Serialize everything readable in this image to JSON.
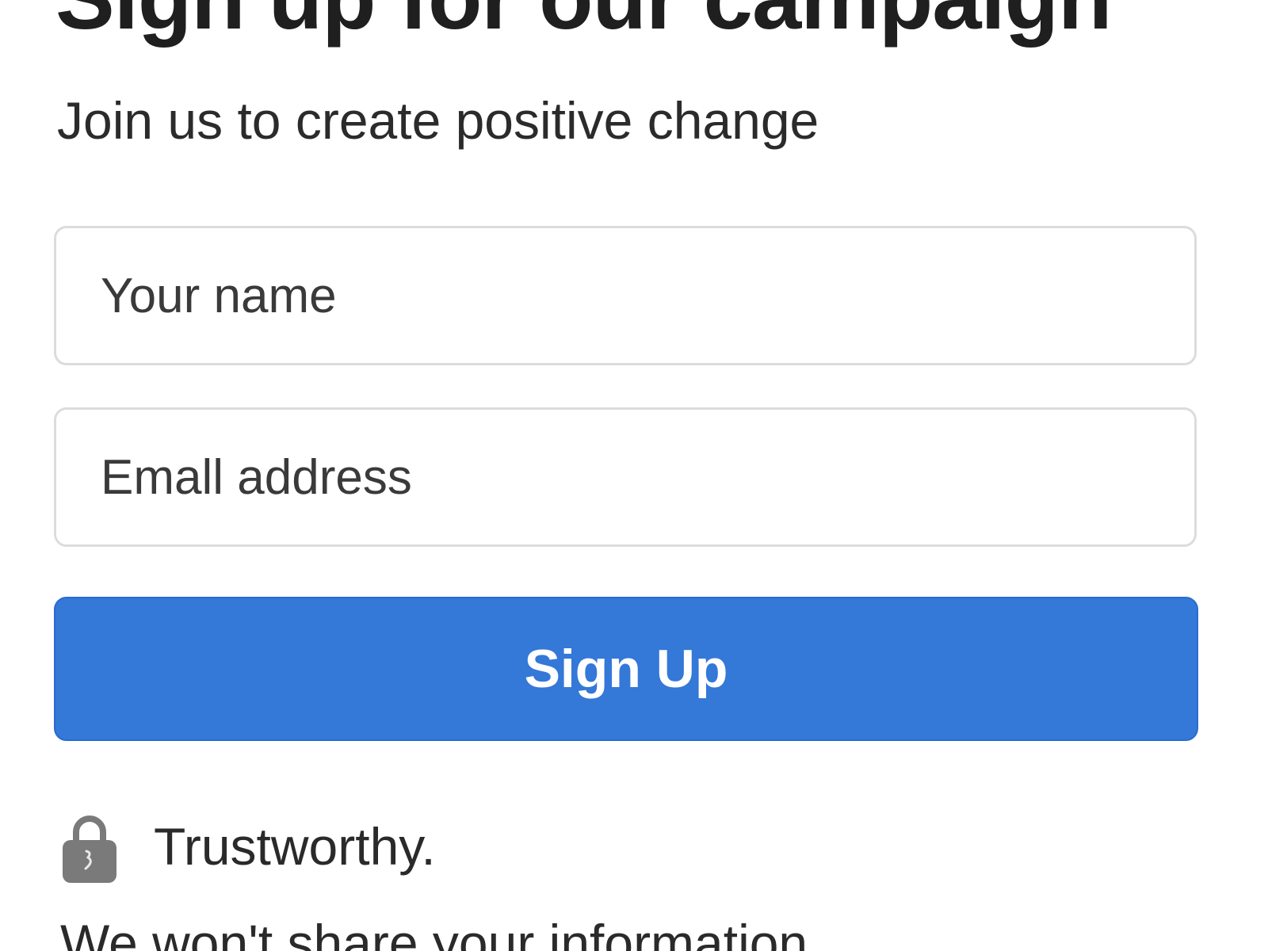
{
  "header": {
    "title": "Sign up for our campaign",
    "subtitle": "Join us to create positive change"
  },
  "form": {
    "name_field": {
      "placeholder": "Your name",
      "value": ""
    },
    "email_field": {
      "placeholder": "Emall address",
      "value": ""
    },
    "submit_label": "Sign Up"
  },
  "trust": {
    "icon": "lock-icon",
    "label": "Trustworthy.",
    "note": "We won't share your information"
  },
  "colors": {
    "button_background": "#3478d8",
    "button_text": "#ffffff",
    "field_border": "#dcdcdc",
    "icon": "#7a7a7a"
  }
}
